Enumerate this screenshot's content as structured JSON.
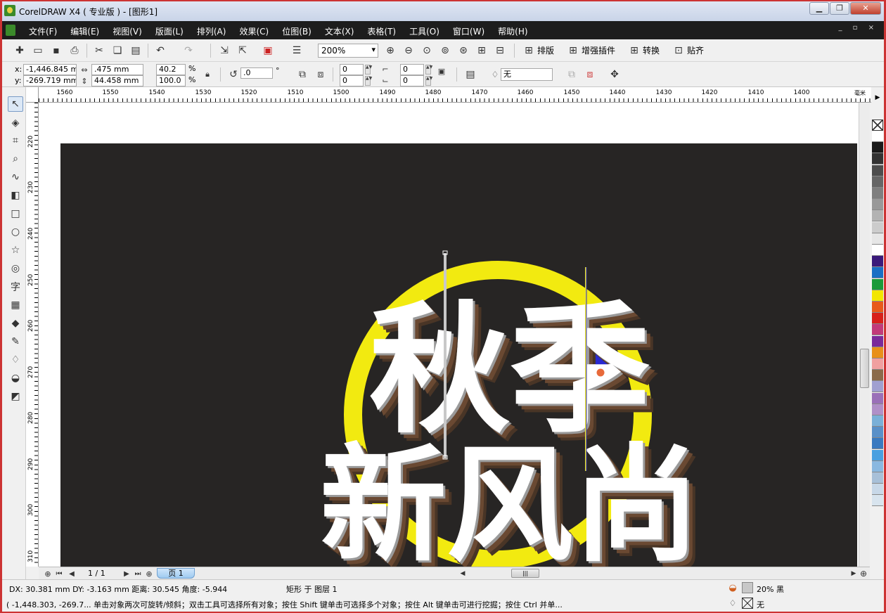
{
  "window": {
    "title": "CorelDRAW X4 ( 专业版 ) - [图形1]",
    "buttons": [
      "▁",
      "❐",
      "✕"
    ]
  },
  "menu": {
    "items": [
      "文件(F)",
      "编辑(E)",
      "视图(V)",
      "版面(L)",
      "排列(A)",
      "效果(C)",
      "位图(B)",
      "文本(X)",
      "表格(T)",
      "工具(O)",
      "窗口(W)",
      "帮助(H)"
    ],
    "doc_controls": "_ ▫ ×"
  },
  "toolbar": {
    "zoom": "200%",
    "text_buttons": [
      "排版",
      "增强插件",
      "转换",
      "贴齐"
    ]
  },
  "property_bar": {
    "x_label": "x:",
    "x_value": "-1,446.845 mm",
    "y_label": "y:",
    "y_value": "-269.719 mm",
    "w_value": ".475 mm",
    "h_value": "44.458 mm",
    "scale_x": "40.2",
    "scale_y": "100.0",
    "pct": "%",
    "angle": ".0",
    "deg": "°",
    "corner_values": [
      "0",
      "0",
      "0",
      "0"
    ],
    "outline": "无"
  },
  "ruler": {
    "h_ticks": [
      "1560",
      "1550",
      "1540",
      "1530",
      "1520",
      "1510",
      "1500",
      "1490",
      "1480",
      "1470",
      "1460",
      "1450",
      "1440",
      "1430",
      "1420",
      "1410",
      "1400"
    ],
    "unit": "毫米",
    "v_ticks": [
      "220",
      "230",
      "240",
      "250",
      "260",
      "270",
      "280",
      "290",
      "300",
      "310"
    ]
  },
  "artwork": {
    "line1": "秋季",
    "line2": "新风尚",
    "ring_color": "#f2ea10",
    "bg_color": "#272524"
  },
  "page_nav": {
    "counter": "1 / 1",
    "tab": "页 1"
  },
  "status": {
    "measure": "DX: 30.381 mm DY: -3.163 mm 距离: 30.545 角度: -5.944",
    "object": "矩形 于 图层 1",
    "fill_label": "20% 黑",
    "outline_label": "无",
    "hint": "( -1,448.303, -269.7... 单击对象两次可旋转/倾斜；双击工具可选择所有对象；按住 Shift 键单击可选择多个对象；按住 Alt 键单击可进行挖掘；按住 Ctrl 并单..."
  },
  "palette": [
    "#ffffff",
    "#1a1a1a",
    "#333333",
    "#4d4d4d",
    "#666666",
    "#7f7f7f",
    "#999999",
    "#b3b3b3",
    "#cccccc",
    "#e6e6e6",
    "#ffffff",
    "#3a1a7a",
    "#1a6fc4",
    "#1a9a3a",
    "#f2e600",
    "#e85a1a",
    "#d8201a",
    "#c23a7a",
    "#7a2a9a",
    "#e8901a",
    "#f0a0a0",
    "#8a6a4a",
    "#a0a0d0",
    "#9a70b8",
    "#b090c8",
    "#7ab0d8",
    "#5a90c8",
    "#3a7ac0",
    "#4aa0e0",
    "#8ab8e0",
    "#a8c0d8",
    "#c8d8e8",
    "#d8e4ee"
  ]
}
